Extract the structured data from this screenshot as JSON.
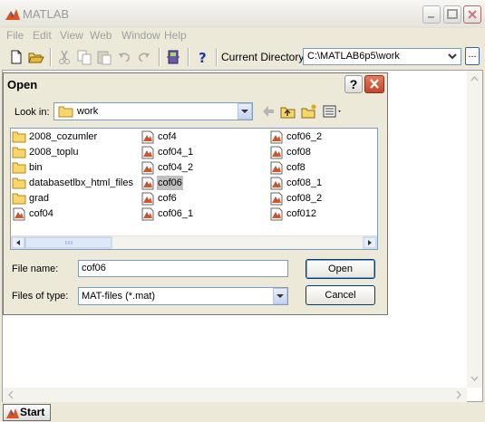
{
  "app": {
    "title": "MATLAB",
    "menu": [
      "File",
      "Edit",
      "View",
      "Web",
      "Window",
      "Help"
    ],
    "toolbar": {
      "current_directory_label": "Current Directory:",
      "current_directory_value": "C:\\MATLAB6p5\\work",
      "browse_label": "..."
    },
    "taskbar": {
      "start_label": "Start"
    }
  },
  "dialog": {
    "title": "Open",
    "help_label": "?",
    "look_in_label": "Look in:",
    "look_in_value": "work",
    "file_list": [
      {
        "name": "2008_cozumler",
        "type": "folder"
      },
      {
        "name": "2008_toplu",
        "type": "folder"
      },
      {
        "name": "bin",
        "type": "folder"
      },
      {
        "name": "databasetlbx_html_files",
        "type": "folder"
      },
      {
        "name": "grad",
        "type": "folder"
      },
      {
        "name": "cof04",
        "type": "mat"
      },
      {
        "name": "cof4",
        "type": "mat"
      },
      {
        "name": "cof04_1",
        "type": "mat"
      },
      {
        "name": "cof04_2",
        "type": "mat"
      },
      {
        "name": "cof06",
        "type": "mat",
        "selected": true
      },
      {
        "name": "cof6",
        "type": "mat"
      },
      {
        "name": "cof06_1",
        "type": "mat"
      },
      {
        "name": "cof06_2",
        "type": "mat"
      },
      {
        "name": "cof08",
        "type": "mat"
      },
      {
        "name": "cof8",
        "type": "mat"
      },
      {
        "name": "cof08_1",
        "type": "mat"
      },
      {
        "name": "cof08_2",
        "type": "mat"
      },
      {
        "name": "cof012",
        "type": "mat"
      }
    ],
    "file_name_label": "File name:",
    "file_name_value": "cof06",
    "files_of_type_label": "Files of type:",
    "files_of_type_value": "MAT-files (*.mat)",
    "open_label": "Open",
    "cancel_label": "Cancel"
  },
  "icons": {
    "app": "matlab-logo-icon",
    "folder": "folder-icon",
    "mat_file": "matlab-file-icon",
    "toolbar": [
      "new-file-icon",
      "open-folder-icon",
      "cut-icon",
      "copy-icon",
      "paste-icon",
      "undo-icon",
      "redo-icon",
      "simulink-icon",
      "help-icon"
    ],
    "dialog_nav": [
      "back-arrow-icon",
      "up-folder-icon",
      "new-folder-icon",
      "view-menu-icon"
    ]
  },
  "colors": {
    "window_bg": "#ece9d8",
    "selection": "#c0c0c0",
    "close_button": "#c2462b",
    "field_border": "#7f9db9"
  }
}
